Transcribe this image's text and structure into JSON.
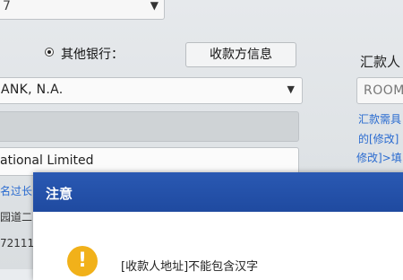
{
  "top_select": {
    "value": "7"
  },
  "receiving_bank": {
    "other_bank_label": "其他银行：",
    "payee_info_button": "收款方信息",
    "bank_name_value": "ANK, N.A.",
    "company_value": "ational Limited",
    "length_note": "名过长",
    "address_prefix": "园道二",
    "number_prefix": "72111"
  },
  "remitter_panel": {
    "title": "汇款人",
    "input_value": "ROOM",
    "note_line1": "汇款需具",
    "note_line2": "的[修改]",
    "note_line3": "修改]>填"
  },
  "dialog": {
    "title": "注意",
    "icon": "warning-icon",
    "message": "[收款人地址]不能包含汉字"
  },
  "colors": {
    "dialog_header": "#2a59b3",
    "link_blue": "#2a6bd0",
    "warning_yellow": "#f1b11a"
  }
}
